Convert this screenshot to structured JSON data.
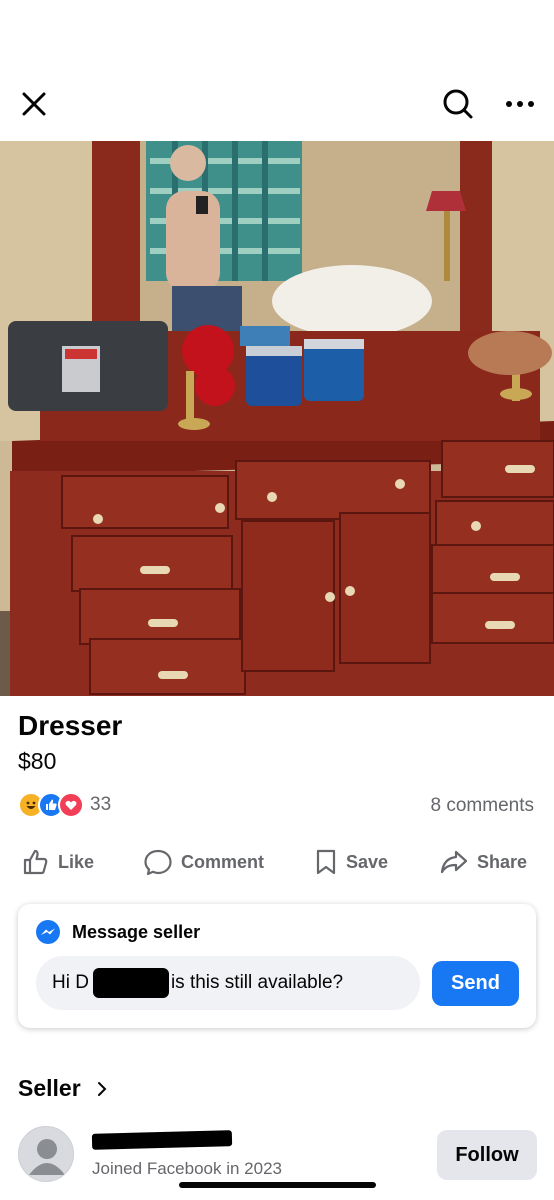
{
  "listing": {
    "title": "Dresser",
    "price": "$80",
    "reaction_count": "33",
    "comments": "8 comments"
  },
  "actions": {
    "like": "Like",
    "comment": "Comment",
    "save": "Save",
    "share": "Share"
  },
  "message": {
    "heading": "Message seller",
    "text_before": "Hi D",
    "text_after": "is this still available?",
    "send": "Send"
  },
  "seller": {
    "heading": "Seller",
    "joined": "Joined Facebook in 2023",
    "follow": "Follow"
  },
  "colors": {
    "accent": "#1877f2",
    "secondary_text": "#65676b",
    "input_bg": "#f0f2f5"
  },
  "icons": [
    "close-icon",
    "search-icon",
    "more-icon",
    "like-icon",
    "comment-icon",
    "save-icon",
    "share-icon",
    "messenger-icon",
    "chevron-right-icon"
  ]
}
